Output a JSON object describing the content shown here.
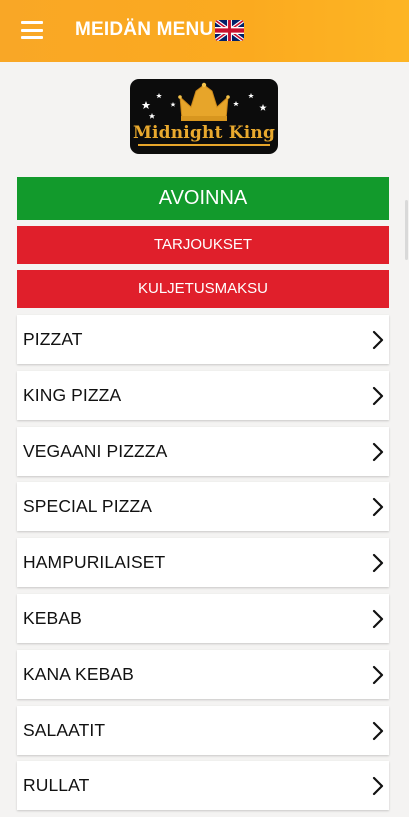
{
  "appbar": {
    "title": "MEIDÄN MENU",
    "menu_icon": "hamburger-icon",
    "language_icon": "uk-flag-icon",
    "background": "#fbaa1f"
  },
  "logo": {
    "text": "Midnight King",
    "icon": "crown-icon"
  },
  "status_banner": {
    "label": "AVOINNA",
    "color": "#129a2c"
  },
  "action_banners": [
    {
      "label": "TARJOUKSET",
      "color": "#e01f2b"
    },
    {
      "label": "KULJETUSMAKSU",
      "color": "#e01f2b"
    }
  ],
  "categories": [
    {
      "label": "PIZZAT"
    },
    {
      "label": "KING PIZZA"
    },
    {
      "label": "VEGAANI PIZZZA"
    },
    {
      "label": "SPECIAL PIZZA"
    },
    {
      "label": "HAMPURILAISET"
    },
    {
      "label": "KEBAB"
    },
    {
      "label": "KANA KEBAB"
    },
    {
      "label": "SALAATIT"
    },
    {
      "label": "RULLAT"
    }
  ],
  "chevron_icon": "chevron-right-icon"
}
